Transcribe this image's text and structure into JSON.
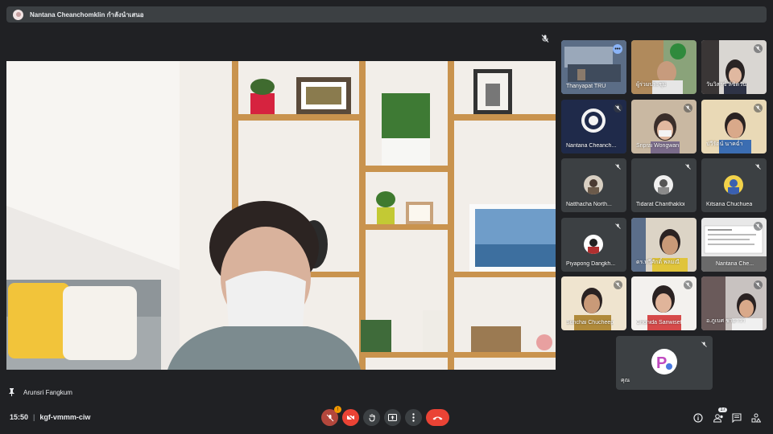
{
  "presenting": {
    "text": "Nantana Cheanchomklin กำลังนำเสนอ"
  },
  "main": {
    "speaker_name": "Arunsri Fangkum"
  },
  "tiles": [
    {
      "label": "Thanyapat TRU"
    },
    {
      "label": "ผู้ร่วมประชุม"
    },
    {
      "label": "วันวิสาข์ ลิขิตวัน"
    },
    {
      "label": "Nantana Cheanch..."
    },
    {
      "label": "Sriprai Wongwan"
    },
    {
      "label": "ปวีรัตน์ นาคฉ่ำ"
    },
    {
      "label": "Natthacha North..."
    },
    {
      "label": "Tidarat Chanthakloi"
    },
    {
      "label": "Kitsana Chuchuea"
    },
    {
      "label": "Piyapong Dangkh..."
    },
    {
      "label": "ดร.ทวีศักดิ์ พลมณี"
    },
    {
      "label": "Nantana Che..."
    },
    {
      "label": "Sunchai Chucheep"
    },
    {
      "label": "Chonida Sanwiset"
    },
    {
      "label": "อ.ภูเบศ ชายาวา"
    },
    {
      "label": "คุณ"
    }
  ],
  "footer": {
    "time": "15:50",
    "meeting_code": "kgf-vmmm-ciw",
    "mic_badge": "!",
    "participants_count": "17"
  },
  "colors": {
    "background": "#202124",
    "tile": "#3c4043",
    "danger": "#ea4335",
    "accent": "#8ab4f8"
  },
  "icons": [
    "mic-off-icon",
    "camera-off-icon",
    "raise-hand-icon",
    "present-icon",
    "more-options-icon",
    "end-call-icon",
    "info-icon",
    "people-icon",
    "chat-icon",
    "activities-icon",
    "pin-icon"
  ]
}
